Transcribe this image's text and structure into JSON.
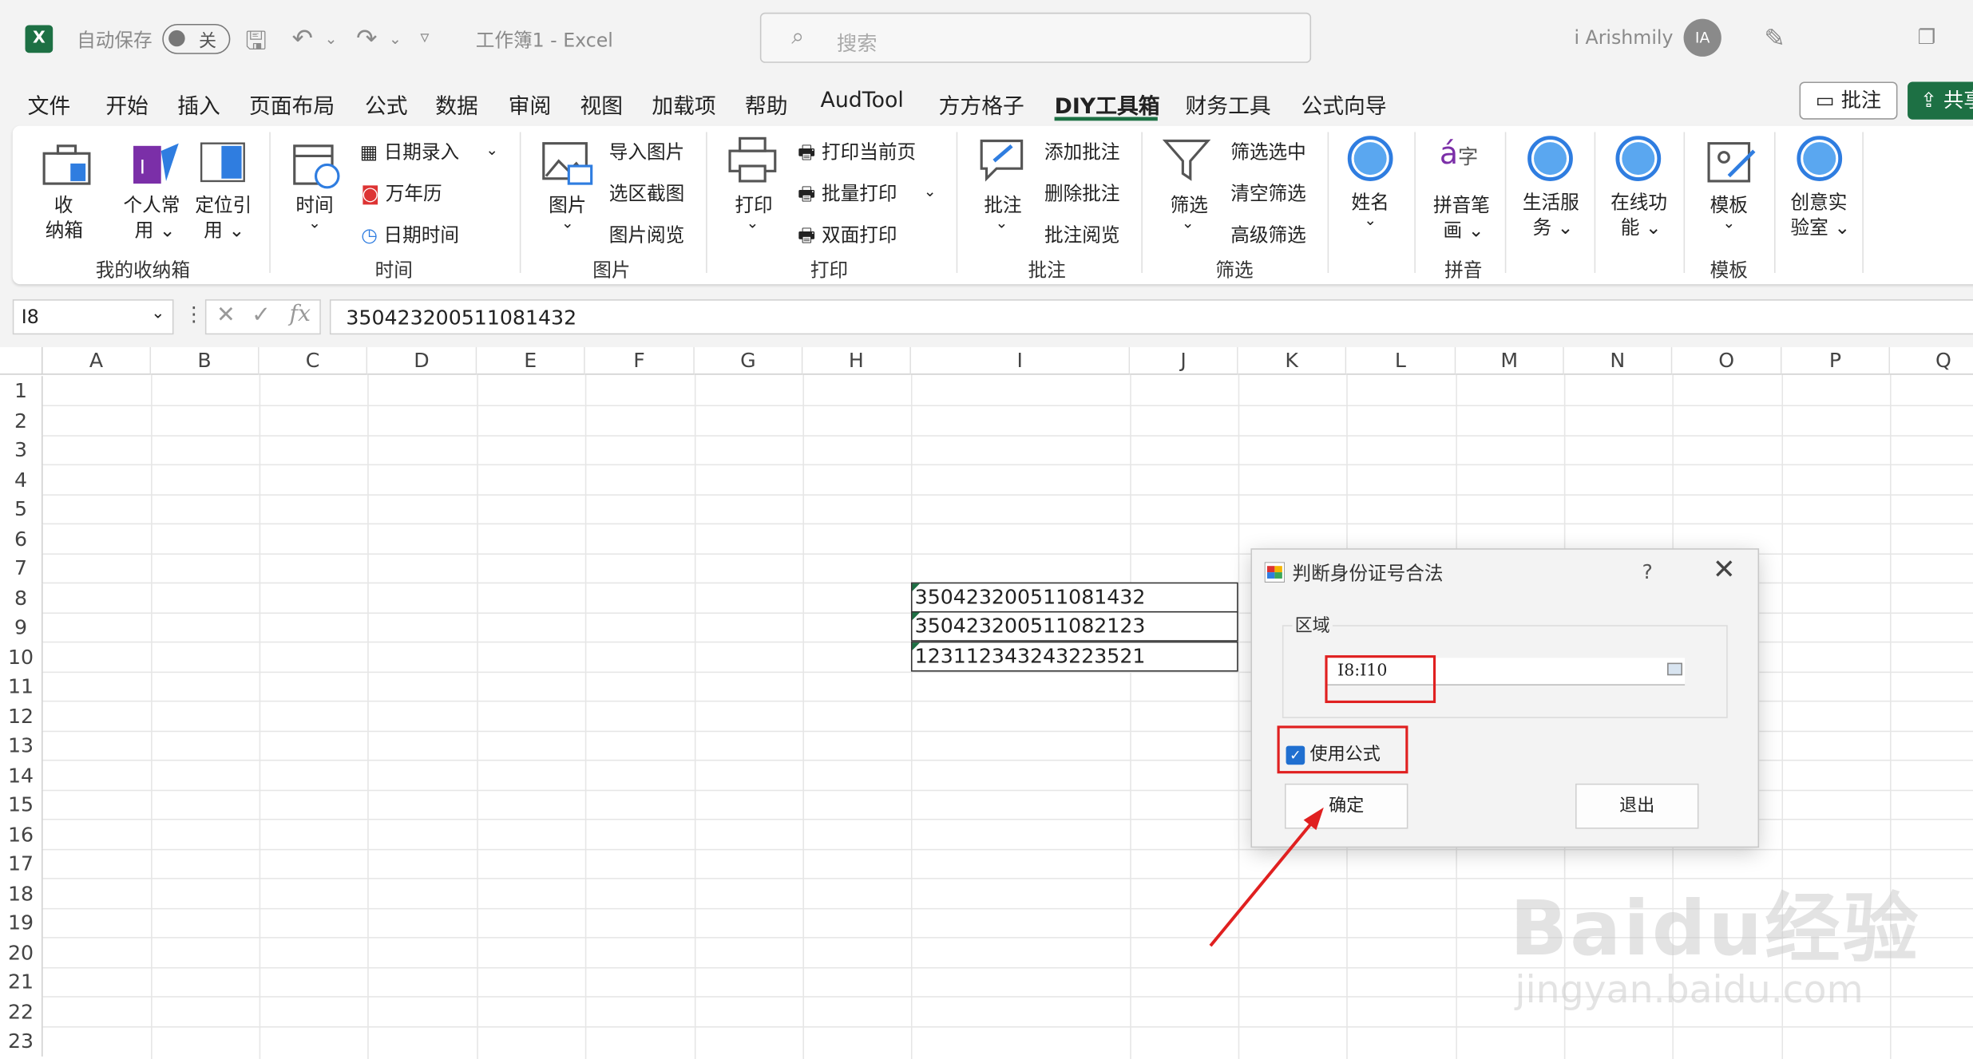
{
  "titlebar": {
    "autosave_label": "自动保存",
    "autosave_state": "关",
    "doc_title": "工作簿1  -  Excel",
    "search_placeholder": "搜索",
    "username": "i Arishmily",
    "avatar_initials": "IA"
  },
  "menu": {
    "items": [
      "文件",
      "开始",
      "插入",
      "页面布局",
      "公式",
      "数据",
      "审阅",
      "视图",
      "加载项",
      "帮助",
      "AudTool",
      "方方格子",
      "DIY工具箱",
      "财务工具",
      "公式向导"
    ],
    "active": "DIY工具箱",
    "comment_button": "批注",
    "share_button": "共享"
  },
  "ribbon": {
    "groups": {
      "storage": "我的收纳箱",
      "time": "时间",
      "picture": "图片",
      "print": "打印",
      "comment": "批注",
      "filter": "筛选",
      "pinyin": "拼音",
      "template": "模板"
    },
    "buttons": {
      "storage_box_1": "收",
      "storage_box_2": "纳箱",
      "personal_1": "个人常",
      "personal_2": "用",
      "locate_1": "定位引",
      "locate_2": "用",
      "time": "时间",
      "date_input": "日期录入",
      "calendar": "万年历",
      "datetime": "日期时间",
      "picture": "图片",
      "import_picture": "导入图片",
      "screenshot": "选区截图",
      "picture_view": "图片阅览",
      "print": "打印",
      "print_current": "打印当前页",
      "batch_print": "批量打印",
      "duplex_print": "双面打印",
      "comment": "批注",
      "add_comment": "添加批注",
      "delete_comment": "删除批注",
      "comment_view": "批注阅览",
      "filter": "筛选",
      "filter_selected": "筛选选中",
      "clear_filter": "清空筛选",
      "advanced_filter": "高级筛选",
      "name": "姓名",
      "pinyin_1": "拼音笔",
      "pinyin_2": "画",
      "life_1": "生活服",
      "life_2": "务",
      "online_1": "在线功",
      "online_2": "能",
      "template": "模板",
      "lab_1": "创意实",
      "lab_2": "验室"
    }
  },
  "formula_bar": {
    "name_box": "I8",
    "fx": "fx",
    "formula": "350423200511081432"
  },
  "grid": {
    "columns": [
      "A",
      "B",
      "C",
      "D",
      "E",
      "F",
      "G",
      "H",
      "I",
      "J",
      "K",
      "L",
      "M",
      "N",
      "O",
      "P",
      "Q"
    ],
    "rows": [
      "1",
      "2",
      "3",
      "4",
      "5",
      "6",
      "7",
      "8",
      "9",
      "10",
      "11",
      "12",
      "13",
      "14",
      "15",
      "16",
      "17",
      "18",
      "19",
      "20",
      "21",
      "22",
      "23"
    ],
    "cells": {
      "I8": "350423200511081432",
      "I9": "350423200511082123",
      "I10": "123112343243223521"
    }
  },
  "dialog": {
    "title": "判断身份证号合法",
    "help": "?",
    "close": "✕",
    "legend": "区域",
    "range_value": "I8:I10",
    "use_formula_label": "使用公式",
    "use_formula_checked": true,
    "ok_button": "确定",
    "exit_button": "退出"
  },
  "watermark": {
    "brand": "Baidu经验",
    "url": "jingyan.baidu.com"
  },
  "colors": {
    "excel_green": "#1d7044",
    "highlight_red": "#e02020",
    "checkbox_blue": "#1f6fd0"
  }
}
